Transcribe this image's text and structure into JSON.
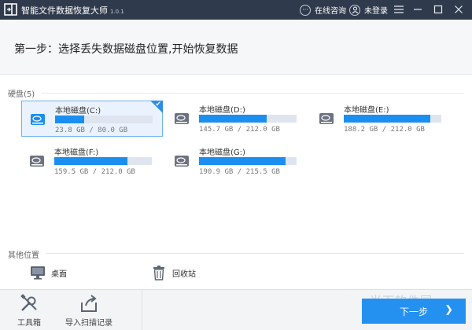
{
  "app": {
    "title": "智能文件数据恢复大师",
    "version": "1.0.1"
  },
  "titlebar": {
    "consult_label": "在线咨询",
    "login_label": "未登录"
  },
  "step": {
    "title": "第一步：选择丢失数据磁盘位置,开始恢复数据"
  },
  "disks": {
    "section_label": "硬盘(5)",
    "items": [
      {
        "name": "本地磁盘(C:)",
        "size": "23.8 GB / 80.0 GB",
        "used_fraction": 0.3,
        "selected": true
      },
      {
        "name": "本地磁盘(D:)",
        "size": "145.7 GB / 212.0 GB",
        "used_fraction": 0.69,
        "selected": false
      },
      {
        "name": "本地磁盘(E:)",
        "size": "188.2 GB / 212.0 GB",
        "used_fraction": 0.89,
        "selected": false
      },
      {
        "name": "本地磁盘(F:)",
        "size": "159.5 GB / 212.0 GB",
        "used_fraction": 0.75,
        "selected": false
      },
      {
        "name": "本地磁盘(G:)",
        "size": "190.9 GB / 215.5 GB",
        "used_fraction": 0.89,
        "selected": false
      }
    ]
  },
  "other": {
    "section_label": "其他位置",
    "items": [
      {
        "label": "桌面",
        "icon": "monitor-icon"
      },
      {
        "label": "回收站",
        "icon": "trash-icon"
      }
    ]
  },
  "bottom": {
    "toolbox_label": "工具箱",
    "import_label": "导入扫描记录",
    "next_label": "下一步",
    "next_arrow": "❯"
  },
  "watermark": "当下软件园",
  "colors": {
    "titlebar": "#2f3a4c",
    "accent": "#2491f0",
    "bar_fill": "#1a8ff0",
    "bar_track": "#dfe5ee"
  }
}
